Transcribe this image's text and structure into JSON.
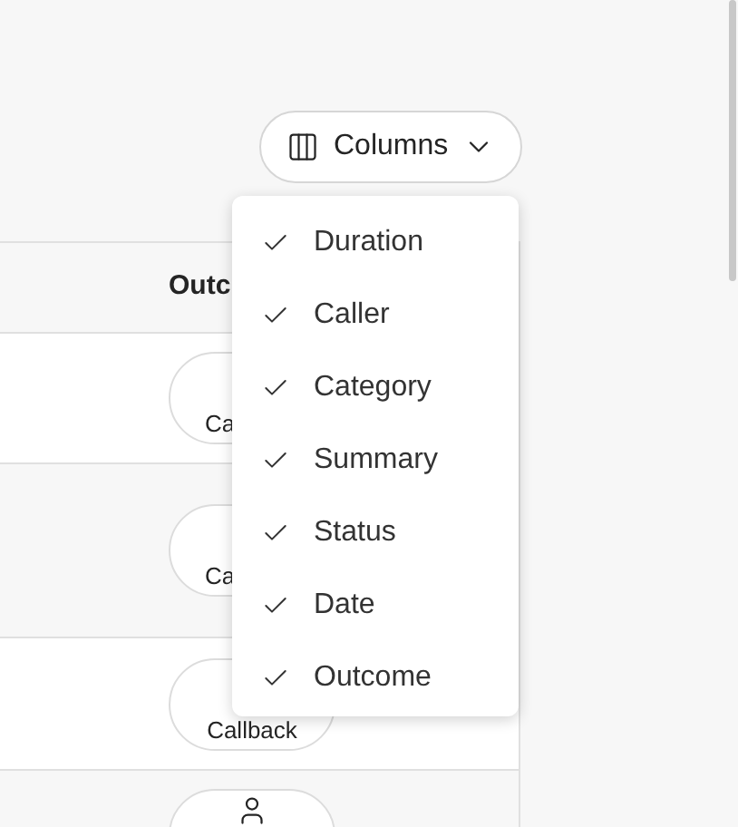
{
  "columns_button": {
    "label": "Columns",
    "expanded": true
  },
  "table": {
    "columns": [
      {
        "label": "Outc"
      }
    ],
    "rows": [
      {
        "outcome": "Ca"
      },
      {
        "outcome": "Ca"
      },
      {
        "outcome": "Callback"
      },
      {}
    ]
  },
  "columns_menu": {
    "items": [
      {
        "label": "Duration",
        "checked": true
      },
      {
        "label": "Caller",
        "checked": true
      },
      {
        "label": "Category",
        "checked": true
      },
      {
        "label": "Summary",
        "checked": true
      },
      {
        "label": "Status",
        "checked": true
      },
      {
        "label": "Date",
        "checked": true
      },
      {
        "label": "Outcome",
        "checked": true
      }
    ]
  }
}
